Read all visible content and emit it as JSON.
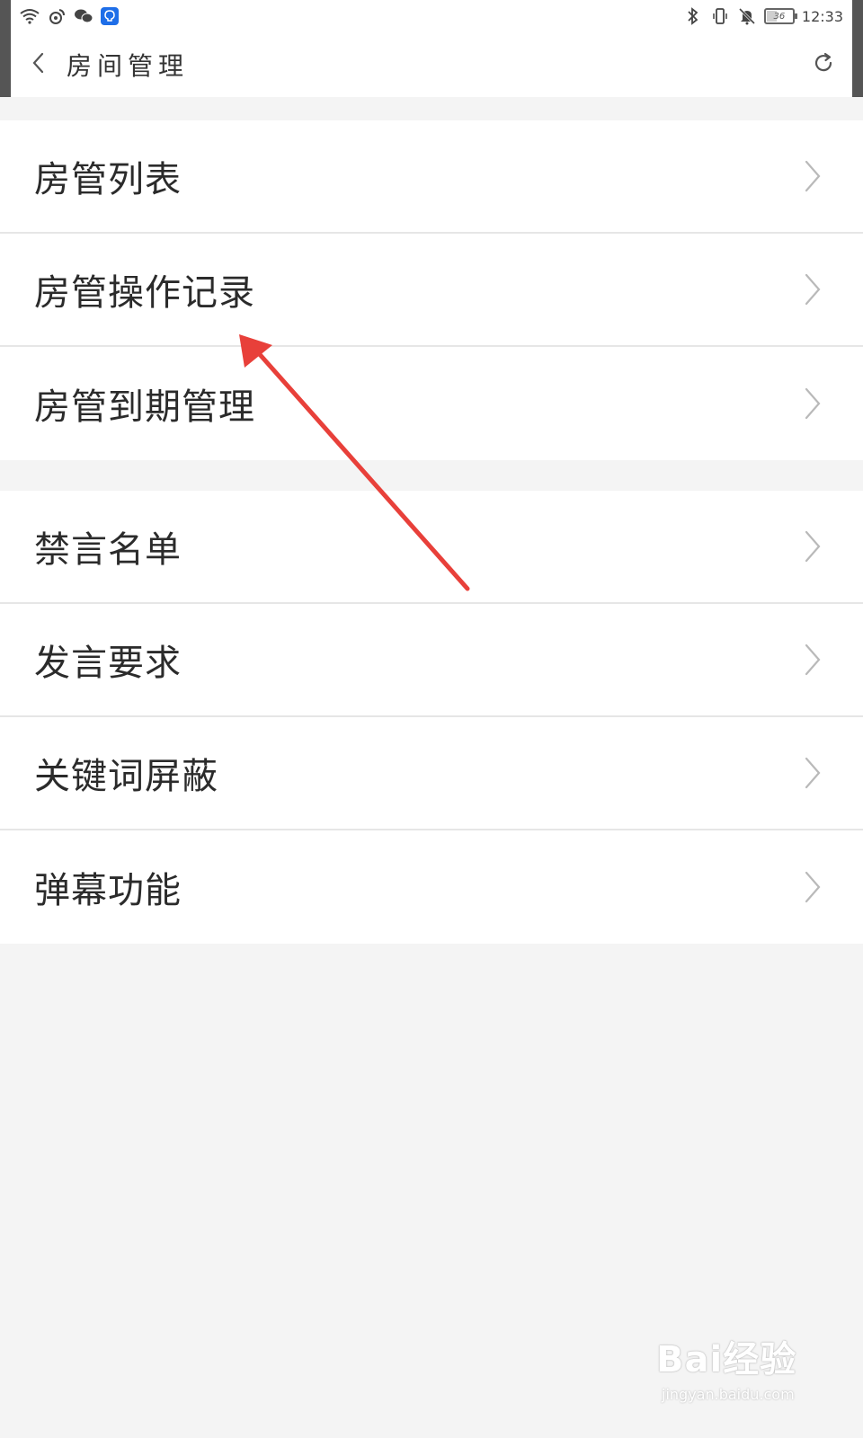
{
  "status_bar": {
    "time": "12:33",
    "battery": "36",
    "battery_level": 0.36,
    "left_icons": [
      "wifi-icon",
      "weibo-icon",
      "wechat-icon",
      "app-notification-icon"
    ],
    "right_icons": [
      "bluetooth-icon",
      "vibrate-icon",
      "mute-icon",
      "battery-icon"
    ]
  },
  "header": {
    "title": "房间管理",
    "back_icon": "chevron-left-icon",
    "refresh_icon": "refresh-icon"
  },
  "groups": [
    {
      "items": [
        {
          "label": "房管列表"
        },
        {
          "label": "房管操作记录"
        },
        {
          "label": "房管到期管理"
        }
      ]
    },
    {
      "items": [
        {
          "label": "禁言名单"
        },
        {
          "label": "发言要求"
        },
        {
          "label": "关键词屏蔽"
        },
        {
          "label": "弹幕功能"
        }
      ]
    }
  ],
  "annotation": {
    "color": "#e8403a",
    "icon": "arrow-annotation-icon"
  },
  "watermark": {
    "main": "Bai经验",
    "sub": "jingyan.baidu.com"
  },
  "colors": {
    "background": "#f4f4f4",
    "row_background": "#ffffff",
    "divider": "#e6e6e6",
    "text": "#2b2b2b",
    "chevron": "#b9b9b9"
  }
}
